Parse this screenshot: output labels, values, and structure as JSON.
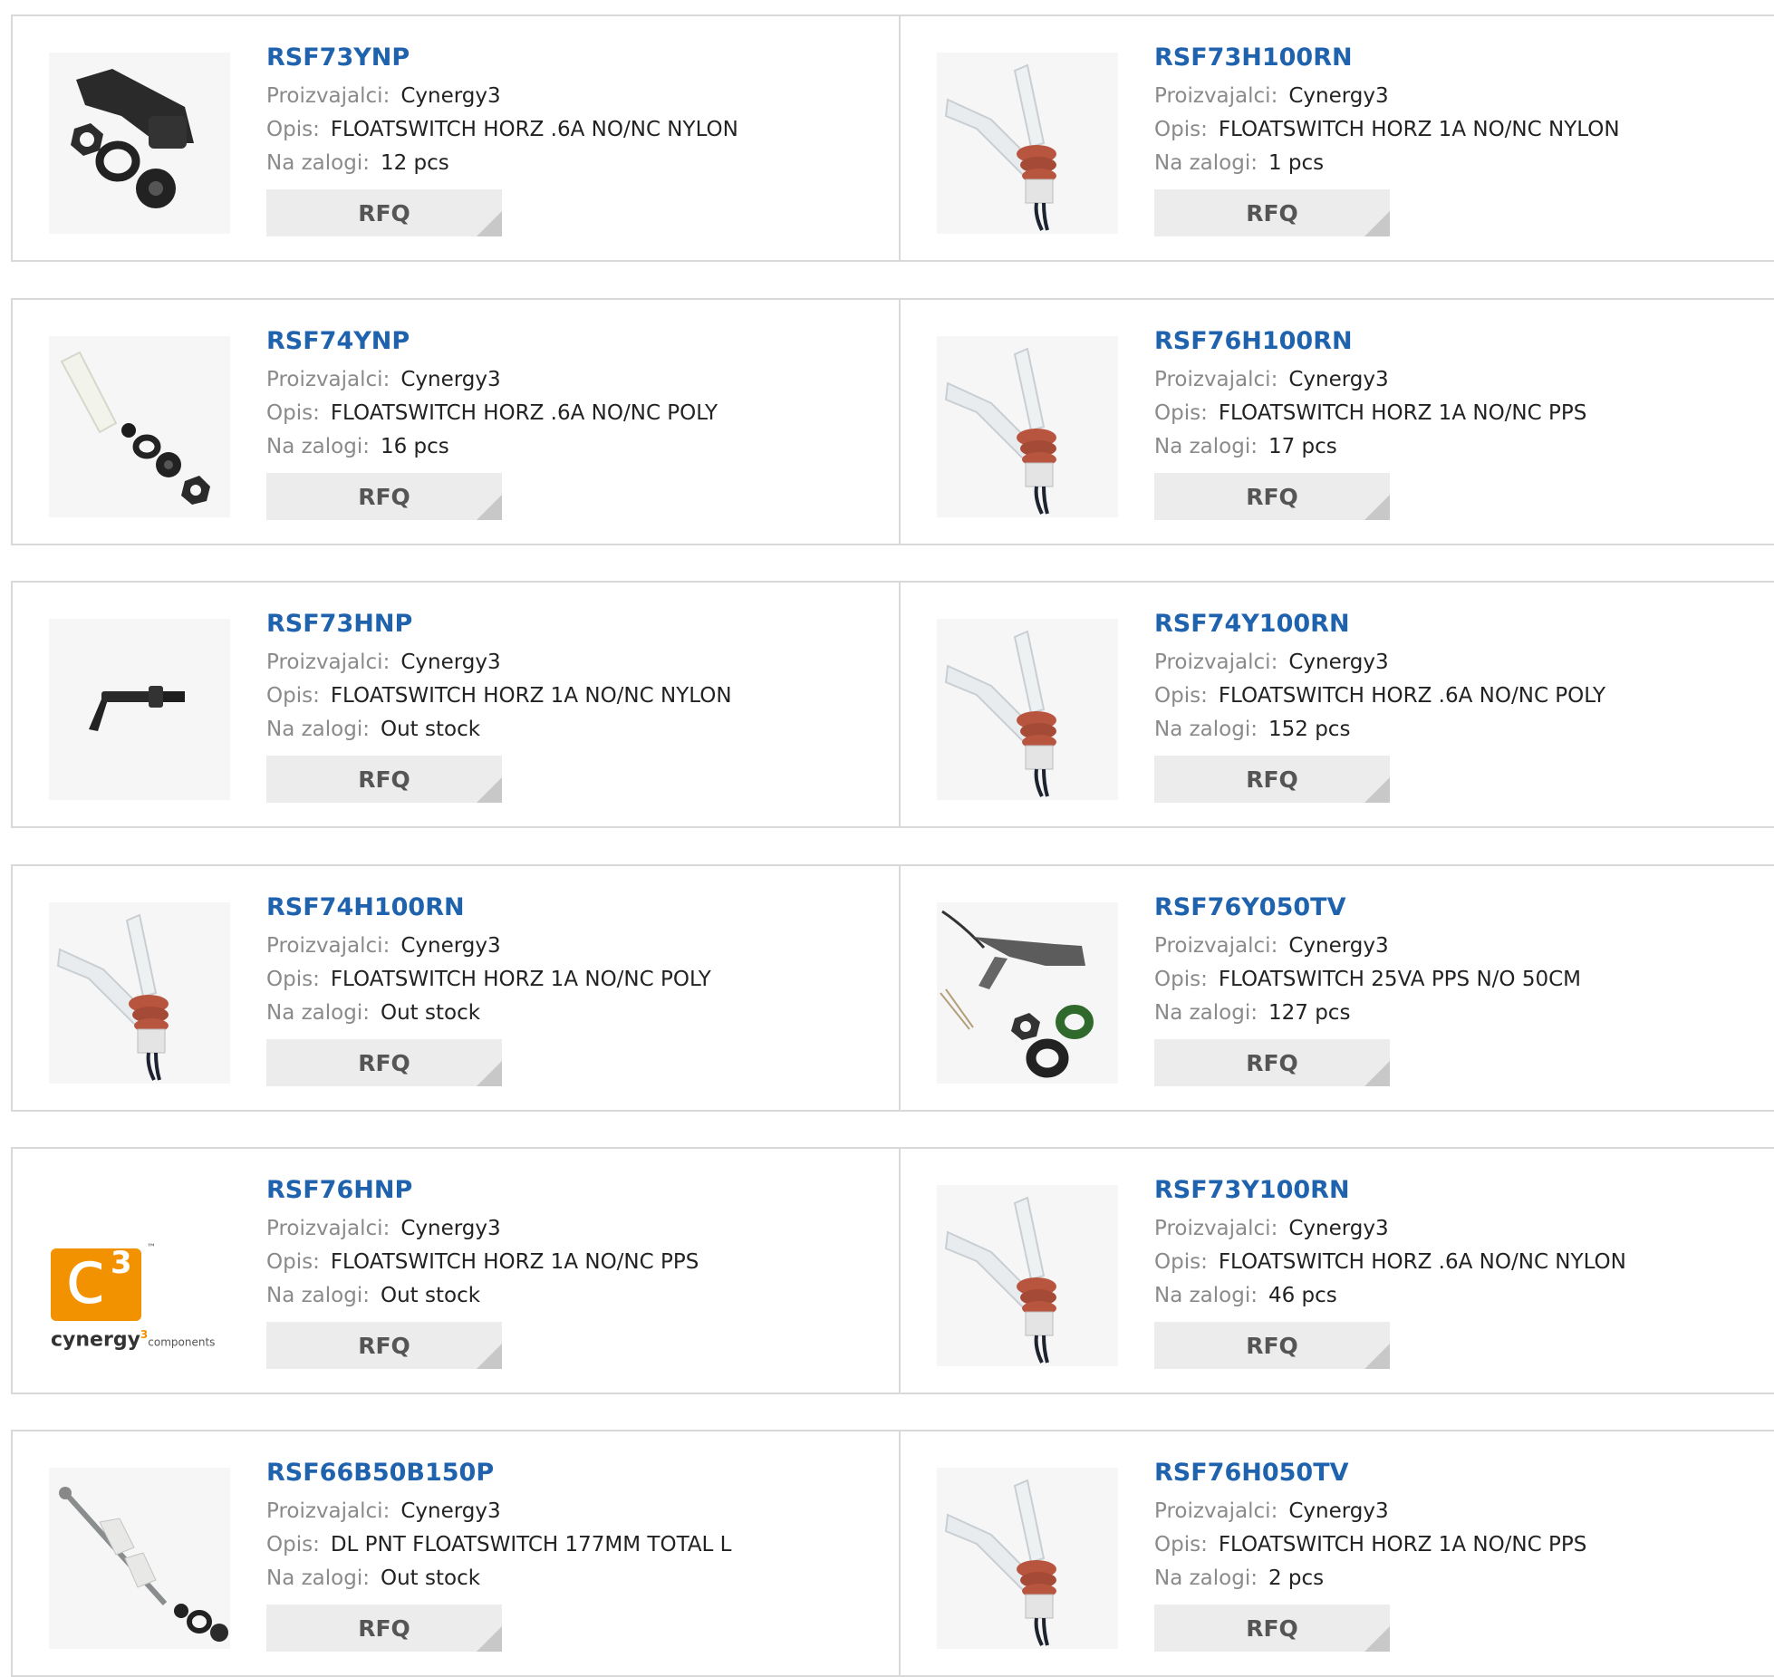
{
  "labels": {
    "manufacturer": "Proizvajalci:",
    "description": "Opis:",
    "stock": "Na zalogi:",
    "rfq": "RFQ"
  },
  "logo": {
    "glyph": "c",
    "superscript": "3",
    "tm": "™",
    "wordmark": "cynergy",
    "wordmark_sup": "3",
    "wordmark_sub": "components"
  },
  "products": [
    {
      "part": "RSF73YNP",
      "manufacturer": "Cynergy3",
      "description": "FLOATSWITCH HORZ .6A NO/NC NYLON",
      "stock": "12 pcs",
      "image": "nylon-kit"
    },
    {
      "part": "RSF73H100RN",
      "manufacturer": "Cynergy3",
      "description": "FLOATSWITCH HORZ 1A NO/NC NYLON",
      "stock": "1 pcs",
      "image": "white-float"
    },
    {
      "part": "RSF74YNP",
      "manufacturer": "Cynergy3",
      "description": "FLOATSWITCH HORZ .6A NO/NC POLY",
      "stock": "16 pcs",
      "image": "poly-kit"
    },
    {
      "part": "RSF76H100RN",
      "manufacturer": "Cynergy3",
      "description": "FLOATSWITCH HORZ 1A NO/NC PPS",
      "stock": "17 pcs",
      "image": "white-float"
    },
    {
      "part": "RSF73HNP",
      "manufacturer": "Cynergy3",
      "description": "FLOATSWITCH HORZ 1A NO/NC NYLON",
      "stock": "Out stock",
      "image": "small-black"
    },
    {
      "part": "RSF74Y100RN",
      "manufacturer": "Cynergy3",
      "description": "FLOATSWITCH HORZ .6A NO/NC POLY",
      "stock": "152 pcs",
      "image": "white-float"
    },
    {
      "part": "RSF74H100RN",
      "manufacturer": "Cynergy3",
      "description": "FLOATSWITCH HORZ 1A NO/NC POLY",
      "stock": "Out stock",
      "image": "white-float"
    },
    {
      "part": "RSF76Y050TV",
      "manufacturer": "Cynergy3",
      "description": "FLOATSWITCH 25VA PPS N/O 50CM",
      "stock": "127 pcs",
      "image": "gray-kit"
    },
    {
      "part": "RSF76HNP",
      "manufacturer": "Cynergy3",
      "description": "FLOATSWITCH HORZ 1A NO/NC PPS",
      "stock": "Out stock",
      "image": "logo"
    },
    {
      "part": "RSF73Y100RN",
      "manufacturer": "Cynergy3",
      "description": "FLOATSWITCH HORZ .6A NO/NC NYLON",
      "stock": "46 pcs",
      "image": "white-float"
    },
    {
      "part": "RSF66B50B150P",
      "manufacturer": "Cynergy3",
      "description": "DL PNT FLOATSWITCH 177MM TOTAL L",
      "stock": "Out stock",
      "image": "vertical"
    },
    {
      "part": "RSF76H050TV",
      "manufacturer": "Cynergy3",
      "description": "FLOATSWITCH HORZ 1A NO/NC PPS",
      "stock": "2 pcs",
      "image": "white-float"
    }
  ]
}
